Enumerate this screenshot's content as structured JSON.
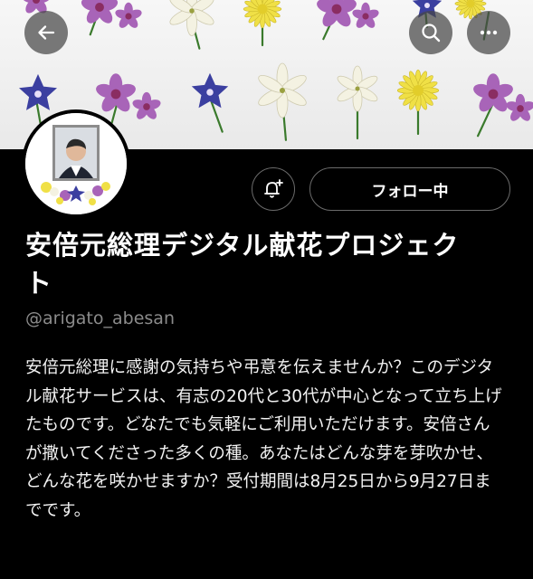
{
  "header": {
    "back_icon": "arrow-left-icon",
    "search_icon": "search-icon",
    "more_icon": "more-horizontal-icon",
    "banner_colors": {
      "orchid": "#a864b8",
      "bellflower": "#3b3fa0",
      "chrysanthemum": "#f0e046",
      "lily": "#f4f2e2",
      "stem": "#3a7a2c"
    }
  },
  "profile": {
    "display_name": "安倍元総理デジタル献花プロジェクト",
    "handle": "@arigato_abesan",
    "follow_button_label": "フォロー中",
    "notify_icon": "bell-plus-icon",
    "bio": "安倍元総理に感謝の気持ちや弔意を伝えませんか？このデジタル献花サービスは、有志の20代と30代が中心となって立ち上げたものです。どなたでも気軽にご利用いただけます。安倍さんが撒いてくださった多くの種。あなたはどんな芽を芽吹かせ、どんな花を咲かせますか？受付期間は8月25日から9月27日までです。"
  }
}
